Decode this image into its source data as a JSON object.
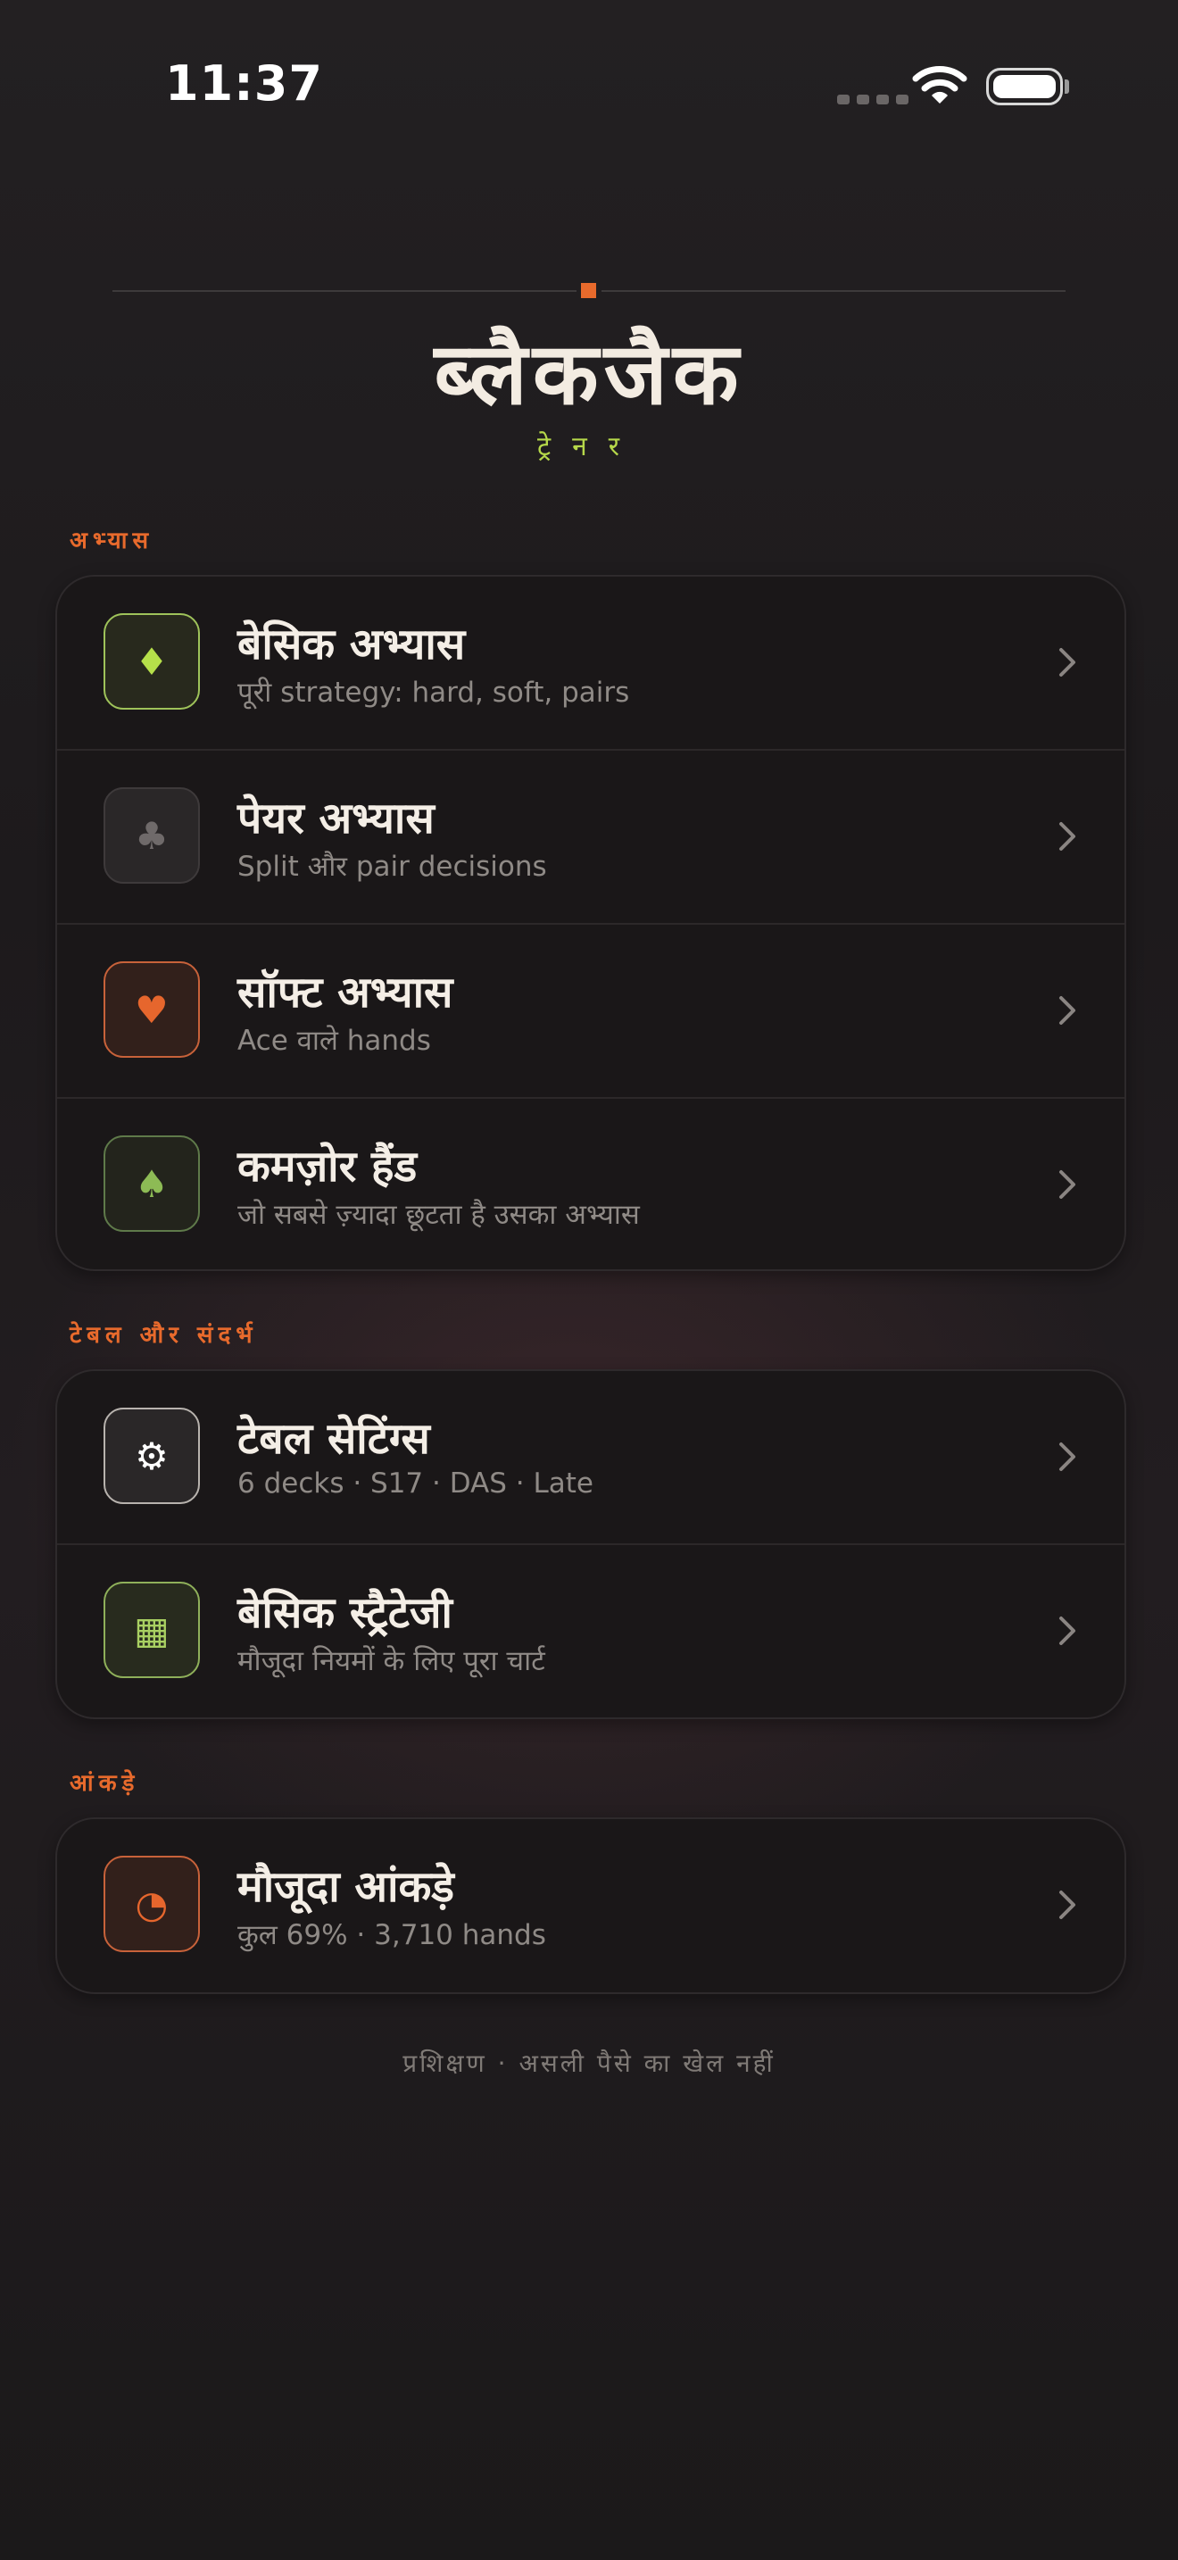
{
  "status_bar": {
    "time": "11:37"
  },
  "header": {
    "title": "ब्लैकजैक",
    "subtitle": "ट्रेनर"
  },
  "sections": {
    "practice": {
      "label": "अभ्यास",
      "items": [
        {
          "title": "बेसिक अभ्यास",
          "subtitle": "पूरी strategy: hard, soft, pairs",
          "icon": "diamond-icon",
          "glyph": "♦"
        },
        {
          "title": "पेयर अभ्यास",
          "subtitle": "Split और pair decisions",
          "icon": "club-icon",
          "glyph": "♣"
        },
        {
          "title": "सॉफ्ट अभ्यास",
          "subtitle": "Ace वाले hands",
          "icon": "heart-icon",
          "glyph": "♥"
        },
        {
          "title": "कमज़ोर हैंड",
          "subtitle": "जो सबसे ज़्यादा छूटता है उसका अभ्यास",
          "icon": "spade-icon",
          "glyph": "♠"
        }
      ]
    },
    "table_reference": {
      "label": "टेबल और संदर्भ",
      "items": [
        {
          "title": "टेबल सेटिंग्स",
          "subtitle": "6 decks · S17 · DAS · Late",
          "icon": "gear-icon",
          "glyph": "⚙"
        },
        {
          "title": "बेसिक स्ट्रैटेजी",
          "subtitle": "मौजूदा नियमों के लिए पूरा चार्ट",
          "icon": "grid-icon",
          "glyph": "▦"
        }
      ]
    },
    "stats": {
      "label": "आंकड़े",
      "items": [
        {
          "title": "मौजूदा आंकड़े",
          "subtitle": "कुल 69% · 3,710 hands",
          "icon": "pie-chart-icon",
          "glyph": "◔"
        }
      ]
    }
  },
  "footer": {
    "text": "प्रशिक्षण · असली पैसे का खेल नहीं"
  },
  "colors": {
    "accent": "#e86a2c",
    "subtitle_green": "#b6d84a",
    "background": "#1f1c1e"
  }
}
